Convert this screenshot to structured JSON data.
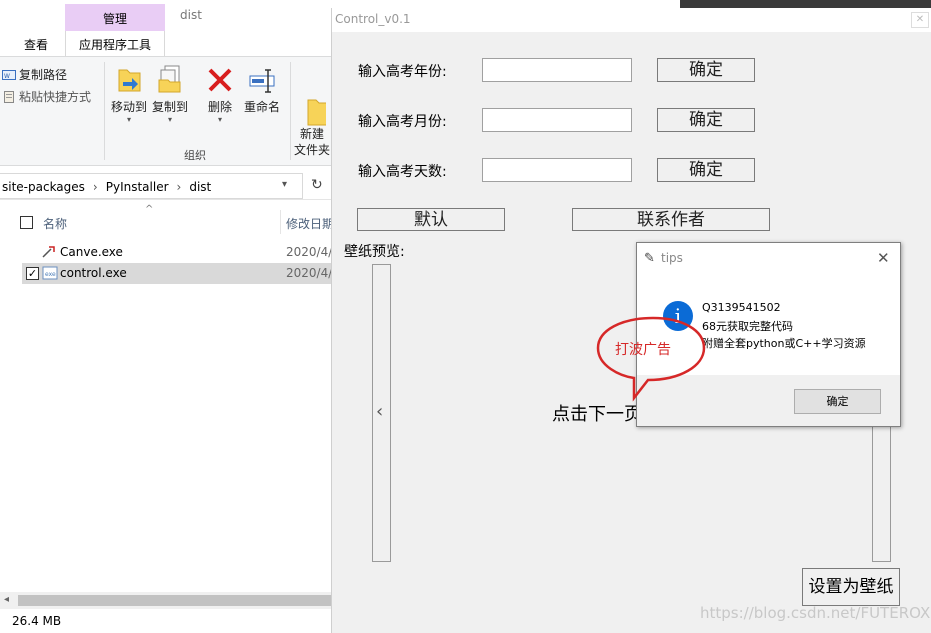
{
  "explorer": {
    "context_group_label": "管理",
    "tabs": [
      "查看",
      "应用程序工具"
    ],
    "window_title": "dist",
    "ribbon": {
      "copy_path": "复制路径",
      "paste_shortcut": "粘贴快捷方式",
      "move_to": "移动到",
      "copy_to": "复制到",
      "delete": "删除",
      "rename": "重命名",
      "new_folder": "新建\n文件夹",
      "group_label": "组织"
    },
    "address": {
      "segments": [
        "site-packages",
        "PyInstaller",
        "dist"
      ]
    },
    "columns": {
      "name": "名称",
      "date": "修改日期"
    },
    "files": [
      {
        "name": "Canve.exe",
        "date": "2020/4/",
        "selected": false
      },
      {
        "name": "control.exe",
        "date": "2020/4/",
        "selected": true
      }
    ],
    "status": "26.4 MB"
  },
  "app": {
    "title": "Control_v0.1",
    "rows": [
      {
        "label": "输入高考年份:",
        "value": "",
        "button": "确定"
      },
      {
        "label": "输入高考月份:",
        "value": "",
        "button": "确定"
      },
      {
        "label": "输入高考天数:",
        "value": "",
        "button": "确定"
      }
    ],
    "default_button": "默认",
    "contact_button": "联系作者",
    "preview_label": "壁纸预览:",
    "prev_arrow": "‹",
    "placeholder": "点击下一页",
    "set_wallpaper_button": "设置为壁纸"
  },
  "tips": {
    "title": "tips",
    "icon_glyph": "i",
    "lines": [
      "Q3139541502",
      "68元获取完整代码",
      "附赠全套python或C++学习资源"
    ],
    "ok_button": "确定",
    "close_glyph": "✕"
  },
  "annotation": {
    "text": "打波广告",
    "color": "#d62828"
  },
  "watermark": "https://blog.csdn.net/FUTEROX",
  "colors": {
    "context_tab": "#e9cdf5",
    "info_icon": "#0b6bd6",
    "selected_row": "#d9d9d9"
  }
}
